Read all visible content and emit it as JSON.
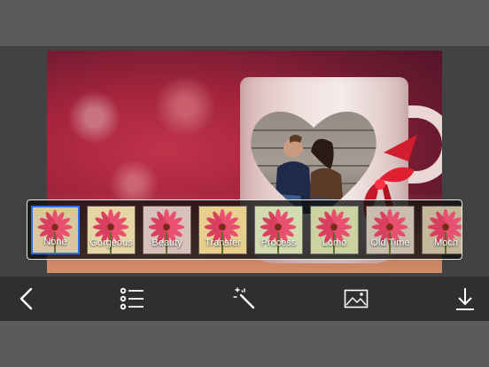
{
  "filters": [
    {
      "label": "None",
      "selected": true,
      "tint": "#d9c7a0"
    },
    {
      "label": "Gorgeous",
      "selected": false,
      "tint": "#e6d6a6"
    },
    {
      "label": "Beauty",
      "selected": false,
      "tint": "#d8c0bb"
    },
    {
      "label": "Transfer",
      "selected": false,
      "tint": "#e8cf8e"
    },
    {
      "label": "Process",
      "selected": false,
      "tint": "#d2dcb0"
    },
    {
      "label": "Lomo",
      "selected": false,
      "tint": "#cdd2a2"
    },
    {
      "label": "Old Time",
      "selected": false,
      "tint": "#c9beae"
    },
    {
      "label": "Moch",
      "selected": false,
      "tint": "#c4b79a"
    }
  ],
  "toolbar": {
    "back_icon": "chevron-left-icon",
    "list_icon": "list-icon",
    "magic_icon": "magic-wand-icon",
    "image_icon": "image-icon",
    "download_icon": "download-icon"
  },
  "colors": {
    "accent": "#2d6ee8"
  }
}
